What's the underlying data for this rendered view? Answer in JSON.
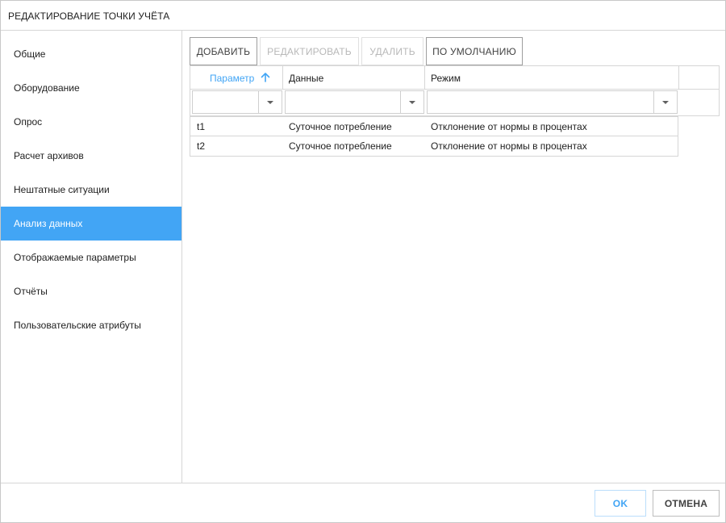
{
  "dialog": {
    "title": "РЕДАКТИРОВАНИЕ ТОЧКИ УЧЁТА"
  },
  "sidebar": {
    "items": [
      {
        "label": "Общие"
      },
      {
        "label": "Оборудование"
      },
      {
        "label": "Опрос"
      },
      {
        "label": "Расчет архивов"
      },
      {
        "label": "Нештатные ситуации"
      },
      {
        "label": "Анализ данных",
        "active": true
      },
      {
        "label": "Отображаемые параметры"
      },
      {
        "label": "Отчёты"
      },
      {
        "label": "Пользовательские атрибуты"
      }
    ]
  },
  "toolbar": {
    "add_label": "ДОБАВИТЬ",
    "edit_label": "РЕДАКТИРОВАТЬ",
    "delete_label": "УДАЛИТЬ",
    "default_label": "ПО УМОЛЧАНИЮ"
  },
  "grid": {
    "columns": [
      {
        "label": "Параметр",
        "sorted": "asc"
      },
      {
        "label": "Данные"
      },
      {
        "label": "Режим"
      }
    ],
    "filters": [
      {
        "value": ""
      },
      {
        "value": ""
      },
      {
        "value": ""
      }
    ],
    "rows": [
      {
        "param": "t1",
        "data": "Суточное потребление",
        "mode": "Отклонение от нормы в процентах"
      },
      {
        "param": "t2",
        "data": "Суточное потребление",
        "mode": "Отклонение от нормы в процентах"
      }
    ]
  },
  "footer": {
    "ok_label": "OK",
    "cancel_label": "ОТМЕНА"
  },
  "colors": {
    "accent": "#42a5f5",
    "border": "#d6d6d6",
    "text": "#212121"
  },
  "icons": {
    "sort": "arrow-up-icon",
    "dropdown": "caret-down-icon"
  }
}
